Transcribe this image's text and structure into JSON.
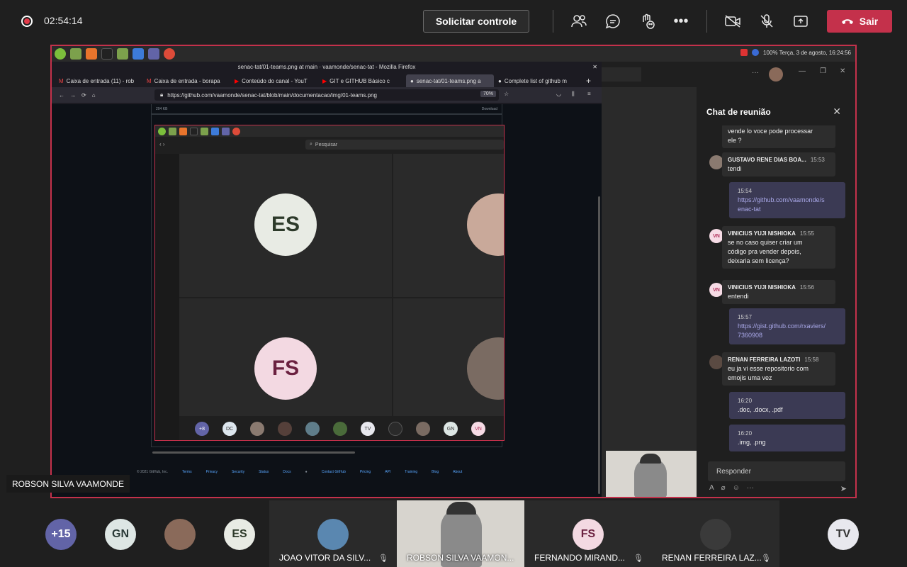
{
  "meeting": {
    "timer": "02:54:14",
    "request_control": "Solicitar controle",
    "leave": "Sair"
  },
  "firefox": {
    "title": "senac-tat/01-teams.png at main · vaamonde/senac-tat - Mozilla Firefox",
    "tabs": [
      {
        "label": "Caixa de entrada (11) - rob"
      },
      {
        "label": "Caixa de entrada - borapa"
      },
      {
        "label": "Conteúdo do canal - YouT"
      },
      {
        "label": "GIT e GITHUB Básico c"
      },
      {
        "label": "senac-tat/01-teams.png a"
      },
      {
        "label": "Complete list of github m"
      }
    ],
    "url": "https://github.com/vaamonde/senac-tat/blob/main/documentacao/img/01-teams.png",
    "zoom": "70%",
    "file_size": "204 KB",
    "download": "Download"
  },
  "system_tray": {
    "text": "100% Terça, 3 de agosto, 16:24:56"
  },
  "inner": {
    "search": "Pesquisar",
    "tile_es": "ES",
    "tile_fs": "FS",
    "strip": [
      "+8",
      "DC",
      "",
      "",
      "",
      "",
      "TV",
      "",
      "",
      "GN",
      "VN"
    ]
  },
  "github_footer": [
    "© 2021 GitHub, Inc.",
    "Terms",
    "Privacy",
    "Security",
    "Status",
    "Docs",
    "Contact GitHub",
    "Pricing",
    "API",
    "Training",
    "Blog",
    "About"
  ],
  "chat": {
    "title": "Chat de reunião",
    "messages": [
      {
        "text_1": "vende lo voce pode processar",
        "text_2": "ele ?"
      },
      {
        "who": "GUSTAVO RENE DIAS BOA...",
        "time": "15:53",
        "text": "tendi"
      },
      {
        "time": "15:54",
        "link_1": "https://github.com/vaamonde/s",
        "link_2": "enac-tat"
      },
      {
        "who": "VINICIUS YUJI NISHIOKA",
        "time": "15:55",
        "initials": "VN",
        "text_1": "se no caso quiser criar um",
        "text_2": "código pra vender depois,",
        "text_3": "deixaria sem licença?"
      },
      {
        "who": "VINICIUS YUJI NISHIOKA",
        "time": "15:56",
        "initials": "VN",
        "text": "entendi"
      },
      {
        "time": "15:57",
        "link_1": "https://gist.github.com/rxaviers/",
        "link_2": "7360908"
      },
      {
        "who": "RENAN FERREIRA LAZOTI",
        "time": "15:58",
        "text_1": "eu ja vi esse repositorio com",
        "text_2": "emojis uma vez"
      },
      {
        "time": "16:20",
        "text": ".doc, .docx, .pdf"
      },
      {
        "time": "16:20",
        "text": ".img, .png"
      }
    ],
    "reply_placeholder": "Responder"
  },
  "presenter_name": "ROBSON SILVA VAAMONDE",
  "bottom": {
    "overflow": "+15",
    "gn": "GN",
    "es": "ES",
    "fs": "FS",
    "tv": "TV",
    "tiles": [
      {
        "name": "JOAO VITOR DA SILV..."
      },
      {
        "name": "ROBSON SILVA VAAMON..."
      },
      {
        "name": "FERNANDO MIRAND..."
      },
      {
        "name": "RENAN FERREIRA LAZ..."
      }
    ]
  },
  "colors": {
    "leave": "#c4314b",
    "accent": "#6264a7",
    "my_bubble": "#3b3a54"
  }
}
